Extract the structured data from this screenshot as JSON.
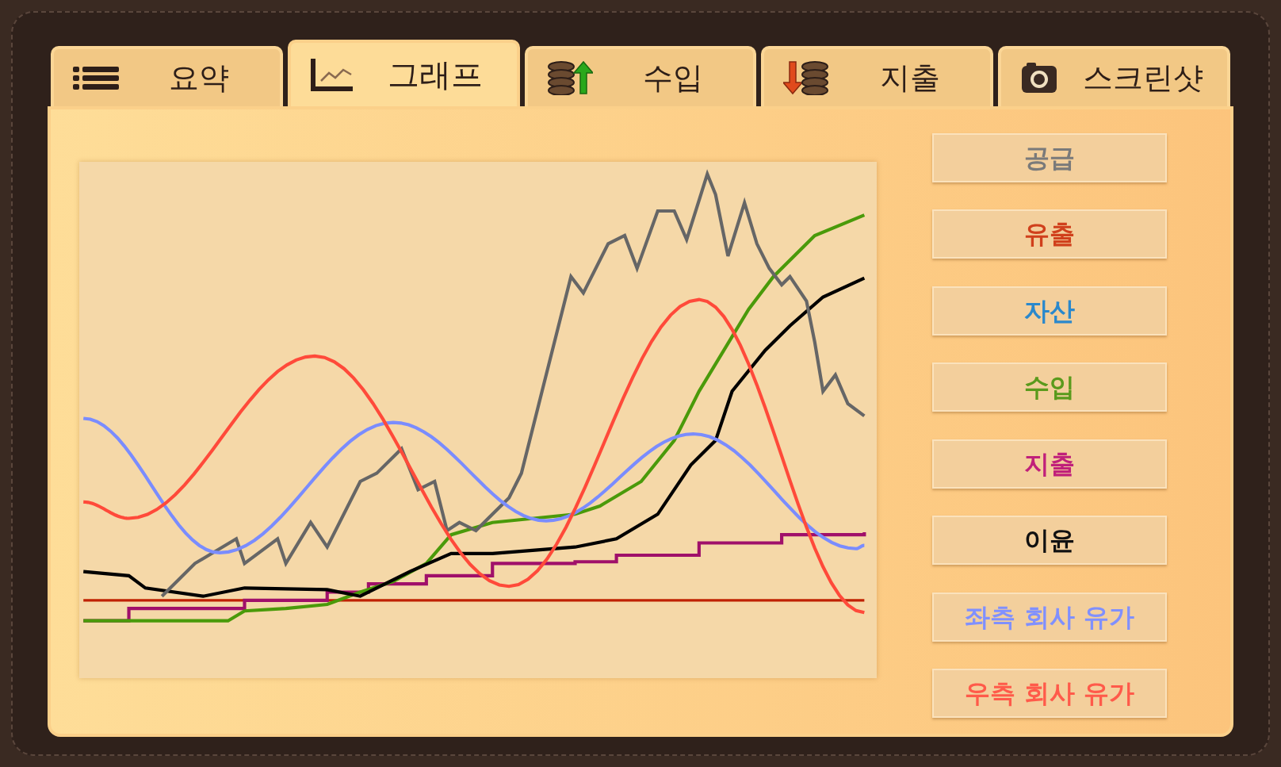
{
  "tabs": [
    {
      "label": "요약",
      "kind": "list",
      "selected": false
    },
    {
      "label": "그래프",
      "kind": "chart",
      "selected": true
    },
    {
      "label": "수입",
      "kind": "income",
      "selected": false
    },
    {
      "label": "지출",
      "kind": "expense",
      "selected": false
    },
    {
      "label": "스크린샷",
      "kind": "screenshot",
      "selected": false
    }
  ],
  "legend_buttons": [
    {
      "label": "공급",
      "color": "#7a7a7a"
    },
    {
      "label": "유출",
      "color": "#d0401c"
    },
    {
      "label": "자산",
      "color": "#2a88cc"
    },
    {
      "label": "수입",
      "color": "#5a9a1c"
    },
    {
      "label": "지출",
      "color": "#c0207a"
    },
    {
      "label": "이윤",
      "color": "#111111"
    },
    {
      "label": "좌측 회사 유가",
      "color": "#8090ff"
    },
    {
      "label": "우측 회사 유가",
      "color": "#ff5a4a"
    }
  ]
}
